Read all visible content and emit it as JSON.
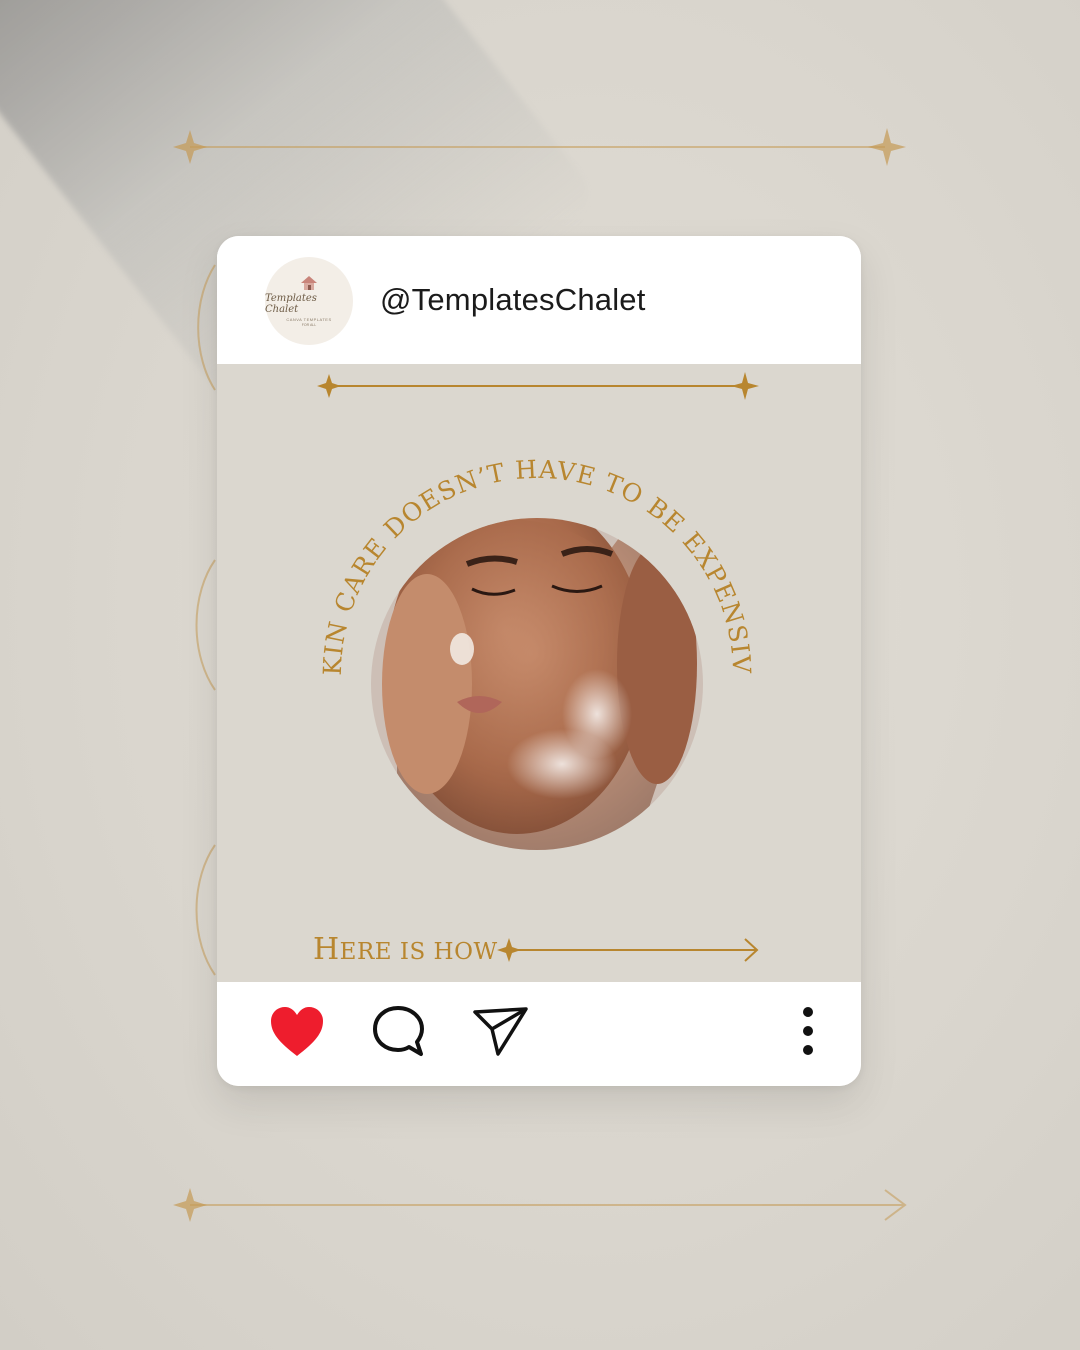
{
  "post": {
    "username": "@TemplatesChalet",
    "avatar": {
      "brand": "Templates Chalet",
      "tagline": "CANVA TEMPLATES",
      "subline": "FOR ALL"
    },
    "arc_text": "SKIN CARE DOESN’T HAVE TO BE EXPENSIVE",
    "cta_first": "H",
    "cta_rest": "ERE IS HOW"
  },
  "actions": {
    "like_icon": "heart-icon",
    "comment_icon": "speech-bubble-icon",
    "share_icon": "paper-plane-icon",
    "more_icon": "vertical-dots-icon"
  },
  "colors": {
    "accent_gold": "#b8862f",
    "like_red": "#ee1d2d",
    "card_body": "#dbd7cf",
    "page_bg": "#d9d5cd"
  }
}
